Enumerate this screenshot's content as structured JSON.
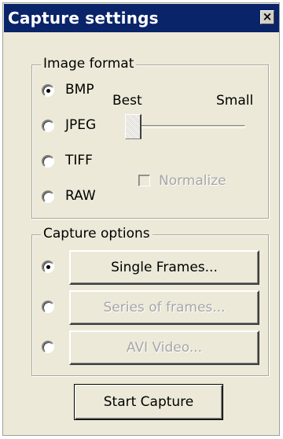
{
  "window": {
    "title": "Capture settings",
    "close_glyph": "×"
  },
  "image_format": {
    "legend": "Image format",
    "options": [
      "BMP",
      "JPEG",
      "TIFF",
      "RAW"
    ],
    "selected": "BMP",
    "quality": {
      "best_label": "Best",
      "small_label": "Small",
      "position": 0
    },
    "normalize": {
      "label": "Normalize",
      "checked": false,
      "enabled": false
    }
  },
  "capture_options": {
    "legend": "Capture options",
    "selected": "Single Frames...",
    "buttons": [
      {
        "label": "Single Frames...",
        "enabled": true
      },
      {
        "label": "Series of frames...",
        "enabled": false
      },
      {
        "label": "AVI Video...",
        "enabled": false
      }
    ]
  },
  "start_button": {
    "label": "Start Capture"
  }
}
